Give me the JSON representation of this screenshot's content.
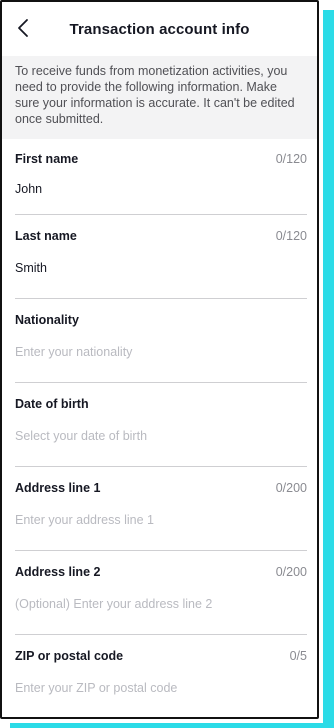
{
  "header": {
    "title": "Transaction account info",
    "back_icon": "chevron-left-icon"
  },
  "notice": {
    "text": "To receive funds from monetization activities, you need to provide the following information. Make sure your information is accurate. It can't be edited once submitted."
  },
  "fields": {
    "first_name": {
      "label": "First name",
      "count": "0/120",
      "value": "John"
    },
    "last_name": {
      "label": "Last name",
      "count": "0/120",
      "value": "Smith"
    },
    "nationality": {
      "label": "Nationality",
      "placeholder": "Enter your nationality"
    },
    "date_of_birth": {
      "label": "Date of birth",
      "placeholder": "Select your date of birth"
    },
    "address_line_1": {
      "label": "Address line 1",
      "count": "0/200",
      "placeholder": "Enter your address line 1"
    },
    "address_line_2": {
      "label": "Address line 2",
      "count": "0/200",
      "placeholder": "(Optional) Enter your address line 2"
    },
    "zip_code": {
      "label": "ZIP or postal code",
      "count": "0/5",
      "placeholder": "Enter your ZIP or postal code"
    }
  },
  "colors": {
    "accent_shadow": "#2bdbe7",
    "border": "#111111",
    "notice_bg": "#f3f3f4",
    "placeholder": "#b9bac0"
  }
}
